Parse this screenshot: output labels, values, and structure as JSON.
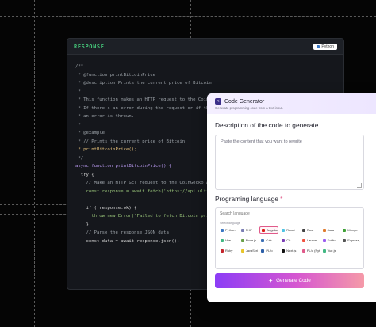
{
  "code_panel": {
    "title": "RESPONSE",
    "language": "Python",
    "lines": [
      {
        "text": "/**",
        "cls": "c-comment"
      },
      {
        "text": " * @function printBitcoinPrice",
        "cls": "c-comment"
      },
      {
        "text": " * @description Prints the current price of Bitcoin.",
        "cls": "c-comment"
      },
      {
        "text": " *",
        "cls": "c-comment"
      },
      {
        "text": " * This function makes an HTTP request to the Coin",
        "cls": "c-comment"
      },
      {
        "text": " * If there's an error during the request or if th",
        "cls": "c-comment"
      },
      {
        "text": " * an error is thrown.",
        "cls": "c-comment"
      },
      {
        "text": " *",
        "cls": "c-comment"
      },
      {
        "text": " * @example",
        "cls": "c-comment"
      },
      {
        "text": " * // Prints the current price of Bitcoin",
        "cls": "c-comment"
      },
      {
        "text": " * printBitcoinPrice();",
        "cls": "c-fn"
      },
      {
        "text": " */",
        "cls": "c-comment"
      },
      {
        "text": "async function printBitcoinPrice() {",
        "cls": "c-kw"
      },
      {
        "text": "  try {",
        "cls": ""
      },
      {
        "text": "    // Make an HTTP GET request to the CoinGecko A",
        "cls": "c-comment"
      },
      {
        "text": "    const response = await fetch('https://api.ulti",
        "cls": "c-str"
      },
      {
        "text": "",
        "cls": ""
      },
      {
        "text": "    if (!response.ok) {",
        "cls": ""
      },
      {
        "text": "      throw new Error('Failed to fetch Bitcoin pri",
        "cls": "c-str"
      },
      {
        "text": "    }",
        "cls": ""
      },
      {
        "text": "    // Parse the response JSON data",
        "cls": "c-comment"
      },
      {
        "text": "    const data = await response.json();",
        "cls": ""
      }
    ]
  },
  "generator": {
    "title": "Code Generator",
    "subtitle": "Generate programming code from a text input.",
    "description_label": "Description of the code to generate",
    "description_placeholder": "Paste the content that you want to rewrite",
    "language_label": "Programing language",
    "required_mark": "*",
    "search_placeholder": "Search language",
    "select_label": "Select language",
    "languages": [
      {
        "name": "Python",
        "color": "#3b78c4",
        "active": false
      },
      {
        "name": "PHP",
        "color": "#7b7fb5",
        "active": false
      },
      {
        "name": "Angular.js",
        "color": "#dd1b16",
        "active": true
      },
      {
        "name": "React",
        "color": "#4fc3e3",
        "active": false
      },
      {
        "name": "Rust",
        "color": "#444444",
        "active": false
      },
      {
        "name": "Java",
        "color": "#e07a2c",
        "active": false
      },
      {
        "name": "Mongo",
        "color": "#3fa037",
        "active": false
      },
      {
        "name": "Vue",
        "color": "#41b883",
        "active": false
      },
      {
        "name": "Node.js",
        "color": "#6aa14a",
        "active": false
      },
      {
        "name": "C++",
        "color": "#3b6fb5",
        "active": false
      },
      {
        "name": "C#",
        "color": "#7a3fb5",
        "active": false
      },
      {
        "name": "Laravel",
        "color": "#f05340",
        "active": false
      },
      {
        "name": "Kotlin",
        "color": "#9a5cf0",
        "active": false
      },
      {
        "name": "Express.js",
        "color": "#555555",
        "active": false
      },
      {
        "name": "Ruby",
        "color": "#c4252c",
        "active": false
      },
      {
        "name": "JavaScript",
        "color": "#e8c52a",
        "active": false
      },
      {
        "name": "PL/o",
        "color": "#2c5fa8",
        "active": false
      },
      {
        "name": "Next.js",
        "color": "#111111",
        "active": false
      },
      {
        "name": "PL/o (Python)",
        "color": "#e05a8a",
        "active": false
      },
      {
        "name": "Vue.js",
        "color": "#41b883",
        "active": false
      }
    ],
    "button_label": "Generate Code"
  }
}
